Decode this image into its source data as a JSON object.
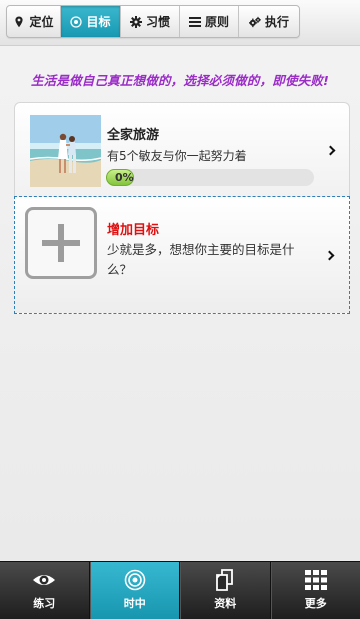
{
  "tabs": [
    {
      "label": "定位",
      "icon": "map-pin-icon",
      "active": false
    },
    {
      "label": "目标",
      "icon": "target-icon",
      "active": true
    },
    {
      "label": "习惯",
      "icon": "gear-icon",
      "active": false
    },
    {
      "label": "原则",
      "icon": "list-icon",
      "active": false
    },
    {
      "label": "执行",
      "icon": "gears-icon",
      "active": false
    }
  ],
  "motto": "生活是做自己真正想做的，选择必须做的，即使失败!",
  "goal": {
    "title": "全家旅游",
    "subtitle": "有5个敏友与你一起努力着",
    "progress": 0,
    "progress_text": "0%"
  },
  "add_goal": {
    "title": "增加目标",
    "subtitle": "少就是多，想想你主要的目标是什么？"
  },
  "bottom_nav": [
    {
      "label": "练习",
      "icon": "eye-icon",
      "active": false
    },
    {
      "label": "时中",
      "icon": "target-circle-icon",
      "active": true
    },
    {
      "label": "资料",
      "icon": "documents-icon",
      "active": false
    },
    {
      "label": "更多",
      "icon": "grid-icon",
      "active": false
    }
  ],
  "colors": {
    "accent": "#1fa3bd",
    "motto": "#9b2cc8",
    "add_title": "#e01010",
    "progress": "#8cc63f"
  }
}
